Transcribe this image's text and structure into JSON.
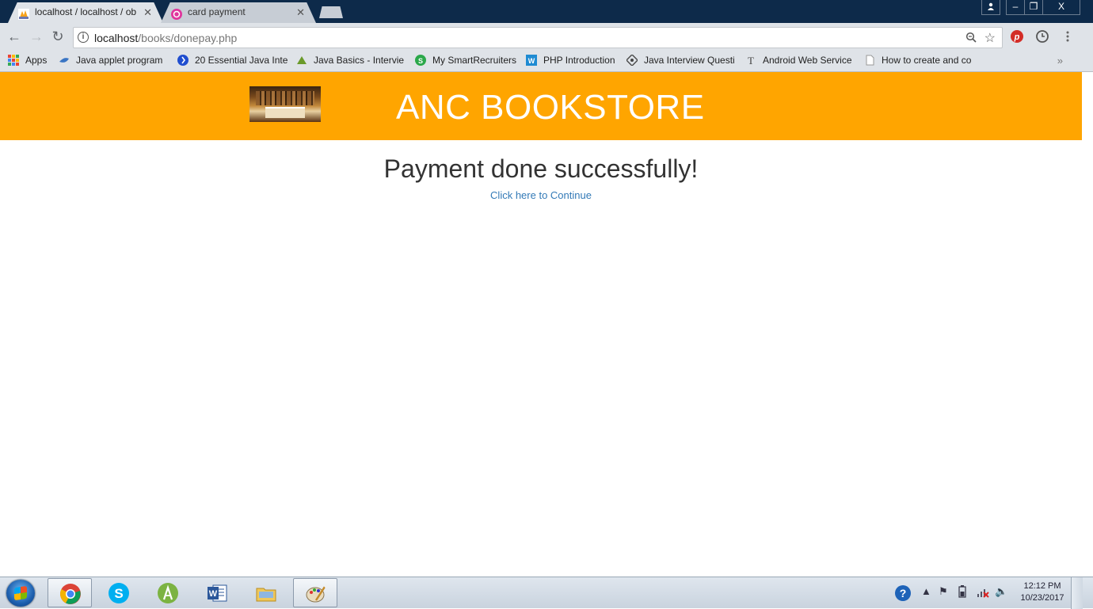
{
  "browser": {
    "tabs": [
      {
        "title": "localhost / localhost / ob",
        "icon": "phpmyadmin-icon"
      },
      {
        "title": "card payment",
        "icon": "page-favicon-icon"
      }
    ],
    "address": {
      "host": "localhost",
      "path": "/books/donepay.php"
    },
    "bookmarks": [
      {
        "label": "Apps",
        "icon": "apps-grid-icon"
      },
      {
        "label": "Java applet program",
        "icon": "bookmark-favicon-icon"
      },
      {
        "label": "20 Essential Java Inte",
        "icon": "toptal-icon"
      },
      {
        "label": "Java Basics - Intervie",
        "icon": "bookmark-favicon-icon"
      },
      {
        "label": "My SmartRecruiters",
        "icon": "smartrecruiters-icon"
      },
      {
        "label": "PHP Introduction",
        "icon": "w3schools-icon"
      },
      {
        "label": "Java Interview Questi",
        "icon": "bookmark-favicon-icon"
      },
      {
        "label": "Android Web Service",
        "icon": "tumblr-t-icon"
      },
      {
        "label": "How to create and co",
        "icon": "page-icon"
      }
    ],
    "more_bookmarks": "»",
    "window_controls": {
      "minimize": "–",
      "restore": "❐",
      "close": "X"
    }
  },
  "page": {
    "brand": "ANC BOOKSTORE",
    "message": "Payment done successfully!",
    "continue_link": "Click here to Continue",
    "header_color": "#ffa500",
    "link_color": "#337ab7"
  },
  "taskbar": {
    "clock_time": "12:12 PM",
    "clock_date": "10/23/2017",
    "apps": [
      "chrome-icon",
      "skype-icon",
      "android-studio-icon",
      "word-icon",
      "file-explorer-icon",
      "paint-icon"
    ]
  }
}
